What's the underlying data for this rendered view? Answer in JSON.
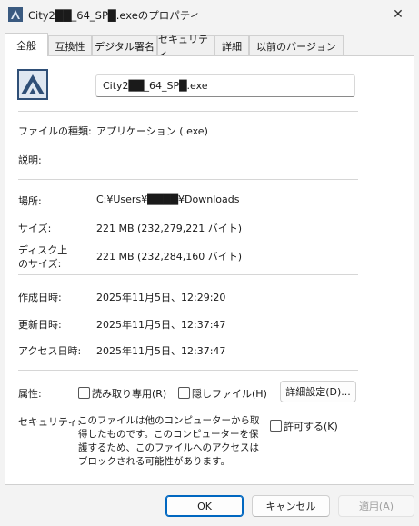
{
  "window": {
    "title": "City2██_64_SP█.exeのプロパティ",
    "close_glyph": "✕"
  },
  "tabs": [
    {
      "label": "全般",
      "active": true
    },
    {
      "label": "互換性"
    },
    {
      "label": "デジタル署名"
    },
    {
      "label": "セキュリティ"
    },
    {
      "label": "詳細"
    },
    {
      "label": "以前のバージョン"
    }
  ],
  "general": {
    "filename": "City2██_64_SP█.exe",
    "file_type": {
      "label": "ファイルの種類:",
      "value": "アプリケーション (.exe)"
    },
    "description": {
      "label": "説明:",
      "value": ""
    },
    "location": {
      "label": "場所:",
      "value": "C:¥Users¥████¥Downloads"
    },
    "size": {
      "label": "サイズ:",
      "value": "221 MB (232,279,221 バイト)"
    },
    "size_on_disk": {
      "label_line1": "ディスク上",
      "label_line2": "のサイズ:",
      "value": "221 MB (232,284,160 バイト)"
    },
    "created": {
      "label": "作成日時:",
      "value": "2025年11月5日、12:29:20"
    },
    "modified": {
      "label": "更新日時:",
      "value": "2025年11月5日、12:37:47"
    },
    "accessed": {
      "label": "アクセス日時:",
      "value": "2025年11月5日、12:37:47"
    },
    "attributes": {
      "label": "属性:",
      "readonly_label": "読み取り専用(R)",
      "hidden_label": "隠しファイル(H)",
      "advanced_button": "詳細設定(D)..."
    },
    "security": {
      "label": "セキュリティ:",
      "text": "このファイルは他のコンピューターから取得したものです。このコンピューターを保護するため、このファイルへのアクセスはブロックされる可能性があります。",
      "allow_label": "許可する(K)"
    }
  },
  "footer": {
    "ok": "OK",
    "cancel": "キャンセル",
    "apply": "適用(A)"
  },
  "colors": {
    "accent": "#0067c0",
    "disabled_text": "#a0a0a0"
  }
}
